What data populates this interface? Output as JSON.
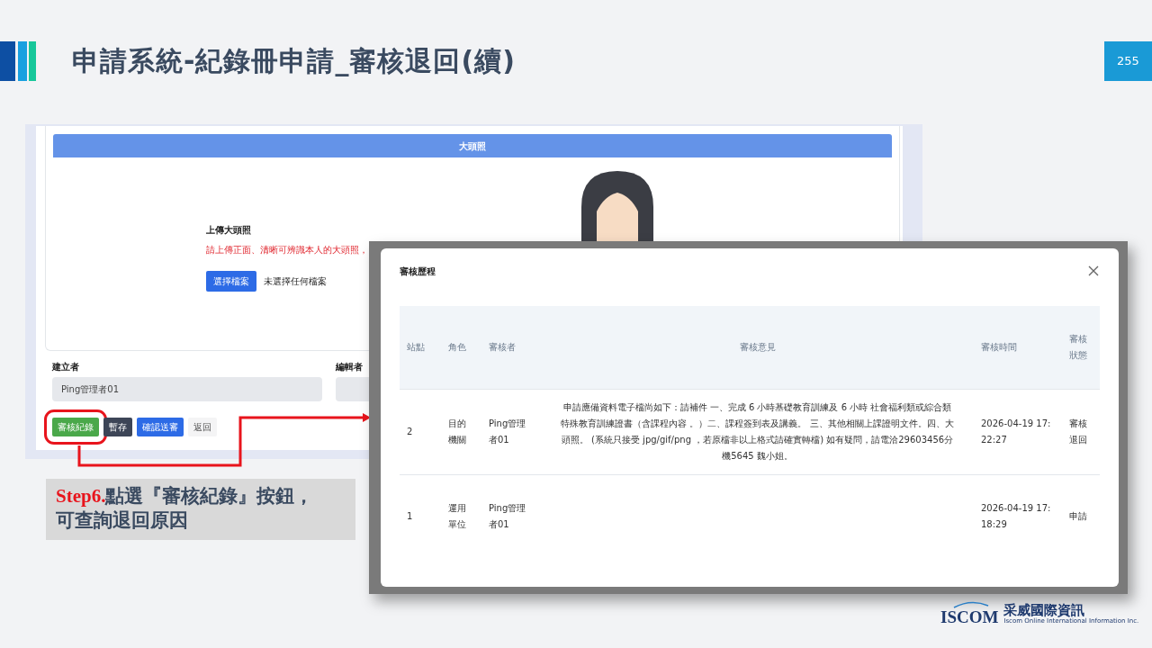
{
  "slide": {
    "title": "申請系統-紀錄冊申請_審核退回(續)",
    "page_number": "255"
  },
  "background_screen": {
    "photo_section": {
      "header": "大頭照",
      "upload_label": "上傳大頭照",
      "upload_hint": "請上傳正面、清晰可辨識本人的大頭照，",
      "choose_button": "選擇檔案",
      "file_status": "未選擇任何檔案"
    },
    "fields": [
      {
        "label": "建立者",
        "value": "Ping管理者01"
      },
      {
        "label": "編輯者"
      }
    ],
    "buttons": [
      {
        "label": "審核紀錄",
        "kind": "success",
        "highlighted": true
      },
      {
        "label": "暫存",
        "kind": "dark",
        "highlighted": false
      },
      {
        "label": "確認送審",
        "kind": "primary",
        "highlighted": false
      },
      {
        "label": "返回",
        "kind": "light",
        "highlighted": false
      }
    ]
  },
  "modal": {
    "title": "審核歷程",
    "columns": [
      "站點",
      "角色",
      "審核者",
      "審核意見",
      "審核時間",
      "審核狀態"
    ],
    "rows": [
      {
        "station": "2",
        "role": "目的機關",
        "reviewer": "Ping管理者01",
        "comment": "申請應備資料電子檔尚如下：請補件 一、完成 6 小時基礎教育訓練及 6 小時 社會福利類或綜合類特殊教育訓練證書（含課程內容 。）二、課程簽到表及講義。 三、其他相關上課證明文件。四、大頭照。 (系統只接受 jpg/gif/png ，若原檔非以上格式請確實轉檔) 如有疑問，請電洽29603456分機5645 魏小姐。",
        "time": "2026-04-19 17:22:27",
        "status": "審核退回"
      },
      {
        "station": "1",
        "role": "運用單位",
        "reviewer": "Ping管理者01",
        "time": "2026-04-19 17:18:29",
        "status": "申請"
      }
    ]
  },
  "caption": "**Step6.**點選『審核紀錄』按鈕，可查詢退回原因",
  "logo": {
    "brand": "ISCOM",
    "chinese_name": "采威國際資訊",
    "tagline": "Iscom Online International Information Inc."
  }
}
